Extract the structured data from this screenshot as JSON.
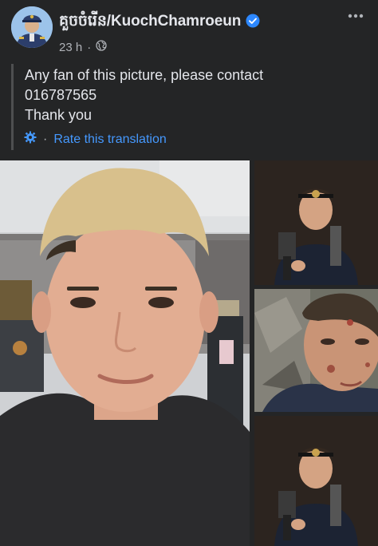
{
  "post": {
    "author_name": "គួចចំរើន/KuochChamroeun",
    "verified_icon": "verified-badge-icon",
    "time_ago": "23 h",
    "separator": "·",
    "audience_icon": "globe-icon",
    "more_icon": "more-options-icon",
    "text_lines": [
      "Any fan of this picture, please contact",
      "016787565",
      "Thank you"
    ],
    "translation": {
      "icon": "gear-icon",
      "separator": "·",
      "link_label": "Rate this translation"
    }
  },
  "photos": [
    {
      "name": "photo-main-selfie"
    },
    {
      "name": "photo-thumb-headlamp"
    },
    {
      "name": "photo-thumb-injured"
    },
    {
      "name": "photo-thumb-headlamp-2"
    }
  ],
  "colors": {
    "background": "#242526",
    "text_primary": "#e4e6eb",
    "text_secondary": "#b0b3b8",
    "link": "#4599ff",
    "verified": "#2d88ff"
  }
}
